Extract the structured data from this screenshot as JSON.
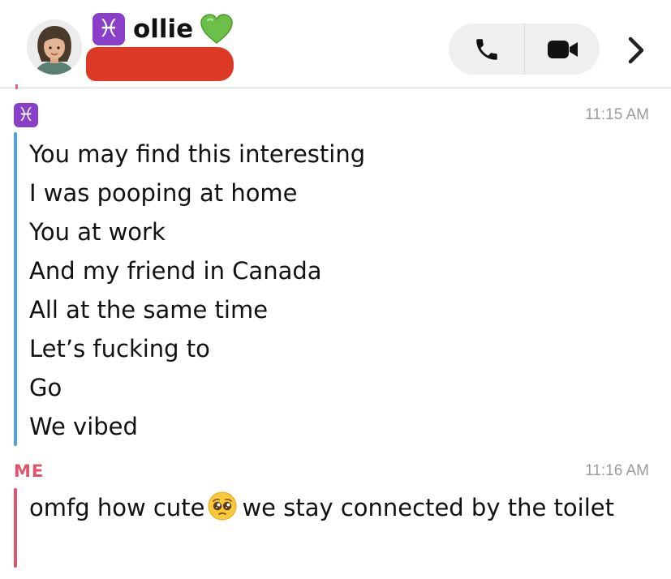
{
  "header": {
    "sign_glyph": "♓",
    "contact_name": "ollie",
    "heart_emoji": "green-heart-icon",
    "subtitle_redacted": true,
    "call_button": "phone-icon",
    "video_button": "video-camera-icon",
    "more_button": "chevron-right-icon"
  },
  "messages": [
    {
      "sender_glyph": "♓",
      "time": "11:15 AM",
      "accent": "#4da3e0",
      "lines": [
        "You may find this interesting",
        "I was pooping at home",
        "You at work",
        "And my friend in Canada",
        "All at the same time",
        "Let’s fucking to",
        "Go",
        "We vibed"
      ]
    },
    {
      "sender": "ME",
      "time": "11:16 AM",
      "accent": "#e0556b",
      "text_before_emoji": "omfg how cute",
      "emoji": "pleading-face-icon",
      "text_after_emoji": "we stay connected by the toilet"
    }
  ],
  "colors": {
    "zodiac_purple": "#8a3fc9",
    "me_red": "#e0556b",
    "friend_blue": "#4da3e0",
    "redaction": "#dc3a24",
    "timestamp_gray": "#9b9b9b"
  }
}
